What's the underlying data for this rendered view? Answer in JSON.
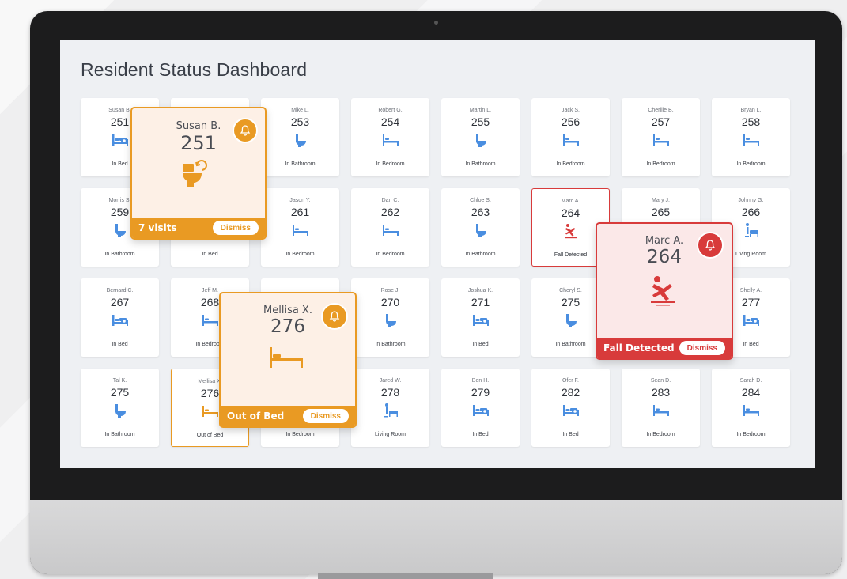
{
  "dashboard": {
    "title": "Resident Status Dashboard"
  },
  "colors": {
    "blue_icon": "#4a8ee0",
    "alert_red": "#d83b3b",
    "alert_orange": "#e99a23"
  },
  "residents": [
    {
      "name": "Susan B.",
      "room": "251",
      "status": "In Bed",
      "icon": "bed-icon",
      "alert": ""
    },
    {
      "name": "",
      "room": "",
      "status": "",
      "icon": "",
      "alert": ""
    },
    {
      "name": "Mike L.",
      "room": "253",
      "status": "In Bathroom",
      "icon": "toilet-icon",
      "alert": ""
    },
    {
      "name": "Robert G.",
      "room": "254",
      "status": "In Bedroom",
      "icon": "bedroom-icon",
      "alert": ""
    },
    {
      "name": "Martin L.",
      "room": "255",
      "status": "In Bathroom",
      "icon": "toilet-icon",
      "alert": ""
    },
    {
      "name": "Jack S.",
      "room": "256",
      "status": "In Bedroom",
      "icon": "bedroom-icon",
      "alert": ""
    },
    {
      "name": "Cherille B.",
      "room": "257",
      "status": "In Bedroom",
      "icon": "bedroom-icon",
      "alert": ""
    },
    {
      "name": "Bryan L.",
      "room": "258",
      "status": "In Bedroom",
      "icon": "bedroom-icon",
      "alert": ""
    },
    {
      "name": "Morris S.",
      "room": "259",
      "status": "In Bathroom",
      "icon": "toilet-icon",
      "alert": ""
    },
    {
      "name": "",
      "room": "",
      "status": "In Bed",
      "icon": "",
      "alert": ""
    },
    {
      "name": "Jason Y.",
      "room": "261",
      "status": "In Bedroom",
      "icon": "bedroom-icon",
      "alert": ""
    },
    {
      "name": "Dan C.",
      "room": "262",
      "status": "In Bedroom",
      "icon": "bedroom-icon",
      "alert": ""
    },
    {
      "name": "Chloe S.",
      "room": "263",
      "status": "In Bathroom",
      "icon": "toilet-icon",
      "alert": ""
    },
    {
      "name": "Marc A.",
      "room": "264",
      "status": "Fall Detected",
      "icon": "fall-icon",
      "alert": "red"
    },
    {
      "name": "Mary J.",
      "room": "265",
      "status": "",
      "icon": "",
      "alert": ""
    },
    {
      "name": "Johnny G.",
      "room": "266",
      "status": "Living Room",
      "icon": "living-room-icon",
      "alert": ""
    },
    {
      "name": "Bernard C.",
      "room": "267",
      "status": "In Bed",
      "icon": "bed-icon",
      "alert": ""
    },
    {
      "name": "Jeff M.",
      "room": "268",
      "status": "In Bedroom",
      "icon": "bedroom-icon",
      "alert": ""
    },
    {
      "name": "",
      "room": "",
      "status": "",
      "icon": "",
      "alert": ""
    },
    {
      "name": "Rose J.",
      "room": "270",
      "status": "In Bathroom",
      "icon": "toilet-icon",
      "alert": ""
    },
    {
      "name": "Joshua K.",
      "room": "271",
      "status": "In Bed",
      "icon": "bed-icon",
      "alert": ""
    },
    {
      "name": "Cheryl S.",
      "room": "275",
      "status": "In Bathroom",
      "icon": "toilet-icon",
      "alert": ""
    },
    {
      "name": "",
      "room": "",
      "status": "",
      "icon": "",
      "alert": ""
    },
    {
      "name": "Shelly A.",
      "room": "277",
      "status": "In Bed",
      "icon": "bed-icon",
      "alert": ""
    },
    {
      "name": "Tal K.",
      "room": "275",
      "status": "In Bathroom",
      "icon": "toilet-icon",
      "alert": ""
    },
    {
      "name": "Mellisa X.",
      "room": "276",
      "status": "Out of Bed",
      "icon": "bedroom-icon",
      "alert": "orange"
    },
    {
      "name": "",
      "room": "",
      "status": "In Bedroom",
      "icon": "",
      "alert": ""
    },
    {
      "name": "Jared W.",
      "room": "278",
      "status": "Living Room",
      "icon": "living-room-icon",
      "alert": ""
    },
    {
      "name": "Ben H.",
      "room": "279",
      "status": "In Bed",
      "icon": "bed-icon",
      "alert": ""
    },
    {
      "name": "Ofer F.",
      "room": "282",
      "status": "In Bed",
      "icon": "bed-icon",
      "alert": ""
    },
    {
      "name": "Sean D.",
      "room": "283",
      "status": "In Bedroom",
      "icon": "bedroom-icon",
      "alert": ""
    },
    {
      "name": "Sarah D.",
      "room": "284",
      "status": "In Bedroom",
      "icon": "bedroom-icon",
      "alert": ""
    }
  ],
  "popups": {
    "susan": {
      "name": "Susan B.",
      "room": "251",
      "footer": "7 visits",
      "dismiss": "Dismiss",
      "icon": "toilet-return-icon"
    },
    "marc": {
      "name": "Marc A.",
      "room": "264",
      "footer": "Fall Detected",
      "dismiss": "Dismiss",
      "icon": "fall-icon"
    },
    "mellisa": {
      "name": "Mellisa X.",
      "room": "276",
      "footer": "Out of Bed",
      "dismiss": "Dismiss",
      "icon": "out-of-bed-icon"
    }
  }
}
